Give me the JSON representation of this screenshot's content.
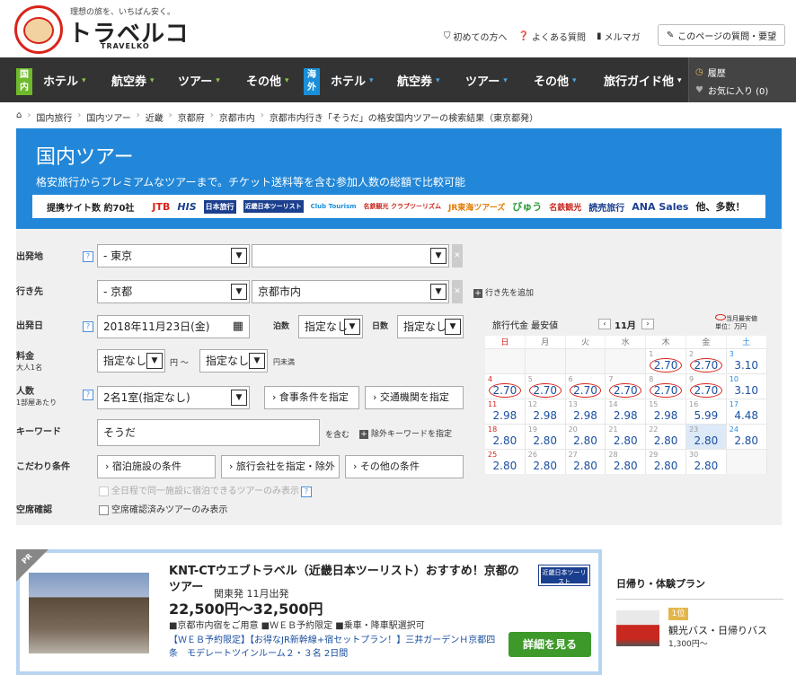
{
  "header": {
    "tagline": "理想の旅を、いちばん安く。",
    "brand": "トラベルコ",
    "brand_en": "TRAVELKO",
    "links": [
      "初めての方へ",
      "よくある質問",
      "メルマガ"
    ],
    "question_button": "このページの質問・要望"
  },
  "nav": {
    "domestic_tag": "国内",
    "overseas_tag": "海外",
    "domestic_items": [
      "ホテル",
      "航空券",
      "ツアー",
      "その他"
    ],
    "overseas_items": [
      "ホテル",
      "航空券",
      "ツアー",
      "その他"
    ],
    "guide": "旅行ガイド他",
    "history": "履歴",
    "favorites": "お気に入り (0)"
  },
  "breadcrumb": [
    "国内旅行",
    "国内ツアー",
    "近畿",
    "京都府",
    "京都市内",
    "京都市内行き「そうだ」の格安国内ツアーの検索結果（東京都発）"
  ],
  "hero": {
    "title": "国内ツアー",
    "subtitle": "格安旅行からプレミアムなツアーまで。チケット送料等を含む参加人数の総額で比較可能",
    "sites_label": "提携サイト数 約70社",
    "site_logos": [
      "JTB",
      "HIS",
      "日本旅行",
      "近畿日本ツーリスト",
      "Club Tourism",
      "名鉄観光 クラブツーリズム",
      "JR東海ツアーズ",
      "びゅう",
      "名鉄観光",
      "読売旅行",
      "ANA Sales"
    ],
    "sites_more": "他、多数！"
  },
  "search": {
    "departure_label": "出発地",
    "departure_value": "- 東京",
    "departure_sub": "",
    "destination_label": "行き先",
    "destination_value": "- 京都",
    "destination_sub": "京都市内",
    "add_destination": "行き先を追加",
    "date_label": "出発日",
    "date_value": "2018年11月23日(金)",
    "nights_label": "泊数",
    "nights_value": "指定なし",
    "days_label": "日数",
    "days_value": "指定なし",
    "fee_label": "料金",
    "fee_sub": "大人1名",
    "fee_min": "指定なし",
    "fee_unit": "円 〜",
    "fee_max": "指定なし",
    "fee_max_unit": "円未満",
    "people_label": "人数",
    "people_sub": "1部屋あたり",
    "people_value": "2名1室(指定なし)",
    "meal_button": "› 食事条件を指定",
    "transport_button": "› 交通機関を指定",
    "keyword_label": "キーワード",
    "keyword_value": "そうだ",
    "keyword_include": "を含む",
    "keyword_exclude": "除外キーワードを指定",
    "pref_label": "こだわり条件",
    "pref_buttons": [
      "› 宿泊施設の条件",
      "› 旅行会社を指定・除外",
      "› その他の条件"
    ],
    "same_hotel": "全日程で同一施設に宿泊できるツアーのみ表示",
    "vacancy_label": "空席確認",
    "vacancy_option": "空席確認済みツアーのみ表示"
  },
  "calendar": {
    "title": "旅行代金 最安値",
    "month": "11月",
    "legend": "当月最安値",
    "unit": "単位：万円",
    "dow": [
      "日",
      "月",
      "火",
      "水",
      "木",
      "金",
      "土"
    ],
    "weeks": [
      [
        {
          "d": "",
          "p": ""
        },
        {
          "d": "",
          "p": ""
        },
        {
          "d": "",
          "p": ""
        },
        {
          "d": "",
          "p": ""
        },
        {
          "d": "1",
          "p": "2.70",
          "low": true
        },
        {
          "d": "2",
          "p": "2.70",
          "low": true
        },
        {
          "d": "3",
          "p": "3.10"
        }
      ],
      [
        {
          "d": "4",
          "p": "2.70",
          "low": true
        },
        {
          "d": "5",
          "p": "2.70",
          "low": true
        },
        {
          "d": "6",
          "p": "2.70",
          "low": true
        },
        {
          "d": "7",
          "p": "2.70",
          "low": true
        },
        {
          "d": "8",
          "p": "2.70",
          "low": true
        },
        {
          "d": "9",
          "p": "2.70",
          "low": true
        },
        {
          "d": "10",
          "p": "3.10"
        }
      ],
      [
        {
          "d": "11",
          "p": "2.98"
        },
        {
          "d": "12",
          "p": "2.98"
        },
        {
          "d": "13",
          "p": "2.98"
        },
        {
          "d": "14",
          "p": "2.98"
        },
        {
          "d": "15",
          "p": "2.98"
        },
        {
          "d": "16",
          "p": "5.99"
        },
        {
          "d": "17",
          "p": "4.48"
        }
      ],
      [
        {
          "d": "18",
          "p": "2.80"
        },
        {
          "d": "19",
          "p": "2.80"
        },
        {
          "d": "20",
          "p": "2.80"
        },
        {
          "d": "21",
          "p": "2.80"
        },
        {
          "d": "22",
          "p": "2.80"
        },
        {
          "d": "23",
          "p": "2.80",
          "hl": true
        },
        {
          "d": "24",
          "p": "2.80"
        }
      ],
      [
        {
          "d": "25",
          "p": "2.80"
        },
        {
          "d": "26",
          "p": "2.80"
        },
        {
          "d": "27",
          "p": "2.80"
        },
        {
          "d": "28",
          "p": "2.80"
        },
        {
          "d": "29",
          "p": "2.80"
        },
        {
          "d": "30",
          "p": "2.80"
        },
        {
          "d": "",
          "p": "",
          "empty": true
        }
      ]
    ]
  },
  "pr": {
    "tag": "PR",
    "title": "KNT-CTウエブトラベル（近畿日本ツーリスト）おすすめ！京都のツアー",
    "meta": "関東発 11月出発",
    "price": "22,500円～32,500円",
    "features": "■京都市内宿をご用意 ■ＷＥＢ予約限定 ■乗車・降車駅選択可",
    "link": "【ＷＥＢ予約限定】【お得なJR新幹線+宿セットプラン！】三井ガーデンＨ京都四条　モデレートツインルーム２・３名 2日間",
    "button": "詳細を見る",
    "logo": "近畿日本ツーリスト"
  },
  "side": {
    "title": "日帰り・体験プラン",
    "rank": "1位",
    "name": "観光バス・日帰りバス",
    "price": "1,300円～"
  }
}
